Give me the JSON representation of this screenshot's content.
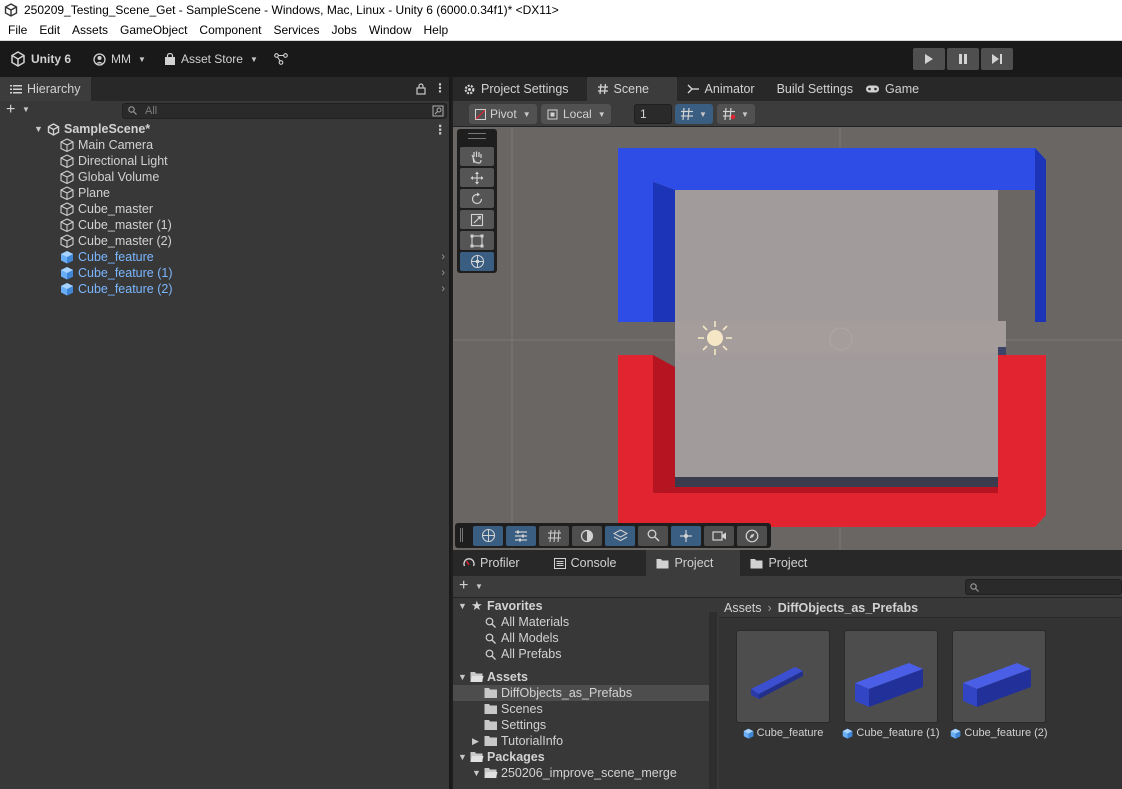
{
  "window": {
    "title": "250209_Testing_Scene_Get - SampleScene - Windows, Mac, Linux - Unity 6 (6000.0.34f1)* <DX11>"
  },
  "menu": [
    "File",
    "Edit",
    "Assets",
    "GameObject",
    "Component",
    "Services",
    "Jobs",
    "Window",
    "Help"
  ],
  "toolbar": {
    "unity_label": "Unity 6",
    "account_label": "MM",
    "asset_store_label": "Asset Store"
  },
  "hierarchy": {
    "tab_label": "Hierarchy",
    "search_placeholder": "All",
    "scene_name": "SampleScene*",
    "items": [
      {
        "label": "Main Camera",
        "prefab": false
      },
      {
        "label": "Directional Light",
        "prefab": false
      },
      {
        "label": "Global Volume",
        "prefab": false
      },
      {
        "label": "Plane",
        "prefab": false
      },
      {
        "label": "Cube_master",
        "prefab": false
      },
      {
        "label": "Cube_master (1)",
        "prefab": false
      },
      {
        "label": "Cube_master (2)",
        "prefab": false
      },
      {
        "label": "Cube_feature",
        "prefab": true
      },
      {
        "label": "Cube_feature (1)",
        "prefab": true
      },
      {
        "label": "Cube_feature (2)",
        "prefab": true
      }
    ]
  },
  "scene_tabs": {
    "project_settings": "Project Settings",
    "scene": "Scene",
    "animator": "Animator",
    "build_settings": "Build Settings",
    "game": "Game"
  },
  "scene_toolbar": {
    "pivot": "Pivot",
    "local": "Local",
    "grid_value": "1"
  },
  "bottom_tabs": {
    "profiler": "Profiler",
    "console": "Console",
    "project_active": "Project",
    "project_second": "Project"
  },
  "project_tree": {
    "favorites": "Favorites",
    "favorite_items": [
      "All Materials",
      "All Models",
      "All Prefabs"
    ],
    "assets": "Assets",
    "asset_folders": [
      "DiffObjects_as_Prefabs",
      "Scenes",
      "Settings",
      "TutorialInfo"
    ],
    "packages": "Packages",
    "package_folders": [
      "250206_improve_scene_merge"
    ]
  },
  "breadcrumb": {
    "root": "Assets",
    "current": "DiffObjects_as_Prefabs"
  },
  "assets": [
    {
      "name": "Cube_feature"
    },
    {
      "name": "Cube_feature (1)"
    },
    {
      "name": "Cube_feature (2)"
    }
  ],
  "colors": {
    "prefab_blue": "#7bb7ff",
    "selection_blue": "#3a5d82",
    "wall_blue": "#2a43d8",
    "wall_red": "#e0222e",
    "plane_gray": "#9e9797"
  }
}
